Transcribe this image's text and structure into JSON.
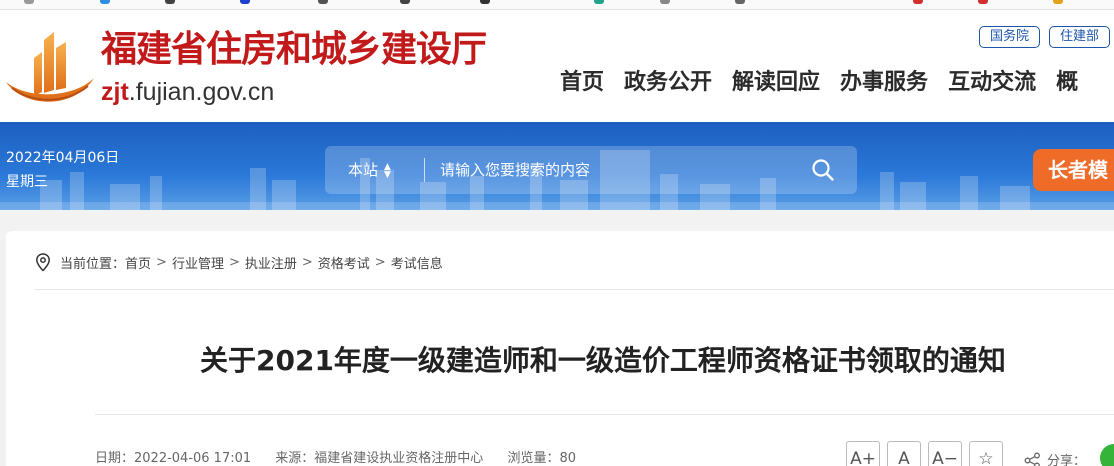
{
  "header": {
    "title": "福建省住房和城乡建设厅",
    "domain_prefix": "zjt",
    "domain_rest": ".fujian.gov.cn",
    "top_links": [
      "国务院",
      "住建部"
    ],
    "nav": [
      "首页",
      "政务公开",
      "解读回应",
      "办事服务",
      "互动交流",
      "概"
    ]
  },
  "banner": {
    "date": "2022年04月06日",
    "weekday": "星期三",
    "search": {
      "scope": "本站",
      "placeholder": "请输入您要搜索的内容"
    },
    "elder_mode": "长者模"
  },
  "breadcrumb": {
    "prefix": "当前位置：",
    "items": [
      "首页",
      "行业管理",
      "执业注册",
      "资格考试",
      "考试信息"
    ],
    "separator": ">"
  },
  "article": {
    "title": "关于2021年度一级建造师和一级造价工程师资格证书领取的通知",
    "date": "日期：2022-04-06 17:01",
    "source": "来源：福建省建设执业资格注册中心",
    "views": "浏览量：80"
  },
  "tools": {
    "font_up": "A+",
    "font_normal": "A",
    "font_down": "A−",
    "favorite": "☆",
    "share_label": "分享："
  },
  "colors": {
    "brand_red": "#c21a1a",
    "nav_blue": "#1d56a8",
    "banner_blue": "#2a78d8",
    "elder_orange": "#ef6b28",
    "wechat_green": "#35b43a"
  }
}
